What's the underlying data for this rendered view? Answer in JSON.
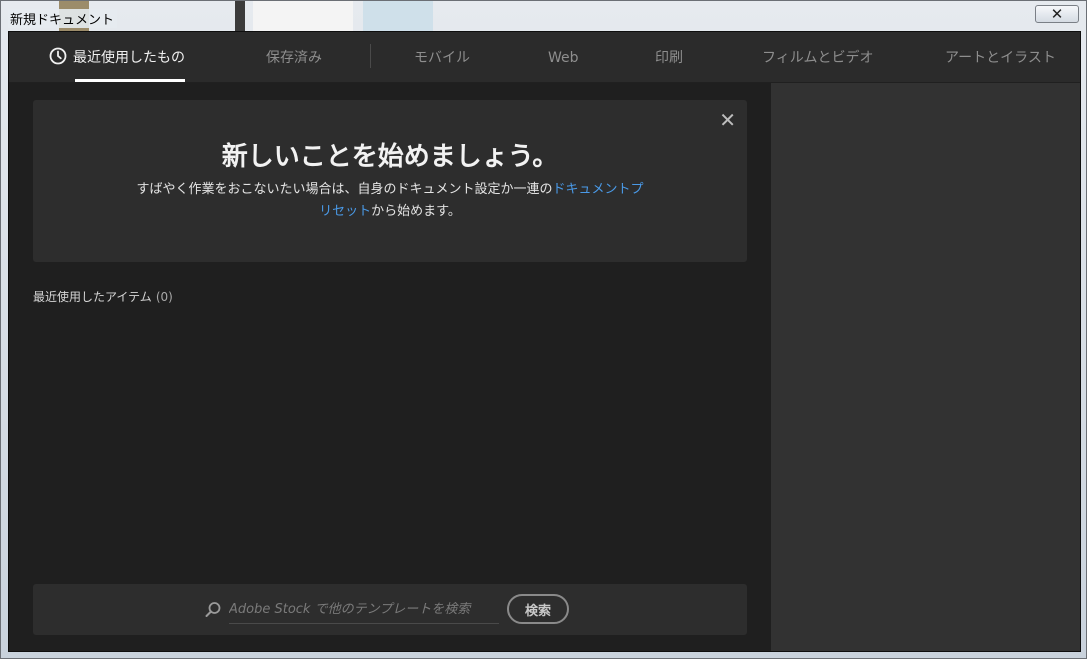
{
  "window": {
    "title": "新規ドキュメント",
    "close_glyph": "✕"
  },
  "tabs": [
    {
      "label": "最近使用したもの",
      "active": true,
      "icon": "clock-icon"
    },
    {
      "label": "保存済み"
    },
    {
      "label": "モバイル"
    },
    {
      "label": "Web"
    },
    {
      "label": "印刷"
    },
    {
      "label": "フィルムとビデオ"
    },
    {
      "label": "アートとイラスト"
    }
  ],
  "hero": {
    "title": "新しいことを始めましょう。",
    "desc_before": "すばやく作業をおこないたい場合は、自身のドキュメント設定か一連の",
    "desc_link": "ドキュメントプリセット",
    "desc_after": "から始めます。",
    "close_glyph": "✕"
  },
  "recent": {
    "label": "最近使用したアイテム",
    "count": "(0)"
  },
  "search": {
    "placeholder": "Adobe Stock で他のテンプレートを検索",
    "value": "",
    "button_label": "検索"
  },
  "colors": {
    "background": "#1f1f1f",
    "panel": "#2d2d2d",
    "right_panel": "#323232",
    "link": "#4a9ae8",
    "active_tab": "#f0f0f0",
    "inactive_tab": "#8e8e8e"
  }
}
